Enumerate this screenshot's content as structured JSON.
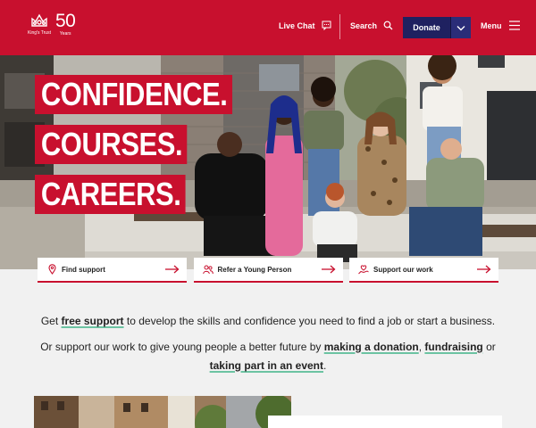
{
  "header": {
    "logo_name": "King's Trust",
    "logo_number": "50",
    "logo_years": "Years",
    "live_chat": "Live Chat",
    "search": "Search",
    "donate": "Donate",
    "menu": "Menu",
    "brand_color": "#c8102e",
    "donate_color": "#1f2160"
  },
  "hero": {
    "lines": [
      "CONFIDENCE.",
      "COURSES.",
      "CAREERS."
    ]
  },
  "cards": [
    {
      "label": "Find support",
      "icon": "location-pin-icon"
    },
    {
      "label": "Refer a Young Person",
      "icon": "people-icon"
    },
    {
      "label": "Support our work",
      "icon": "heart-hand-icon"
    }
  ],
  "intro": {
    "p1_pre": "Get ",
    "p1_link": "free support",
    "p1_post": " to develop the skills and confidence you need to find a job or start a business.",
    "p2_pre": "Or support our work to give young people a better future by ",
    "p2_link1": "making a donation",
    "p2_sep1": ", ",
    "p2_link2": "fundraising",
    "p2_sep2": " or",
    "p2_link3": "taking part in an event",
    "p2_end": "."
  },
  "link_underline_color": "#6cc3a2"
}
